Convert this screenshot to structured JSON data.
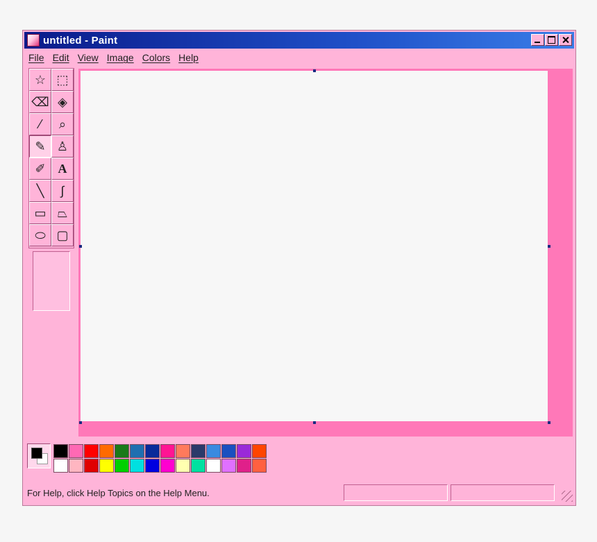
{
  "window": {
    "title": "untitled - Paint"
  },
  "menu": [
    "File",
    "Edit",
    "View",
    "Image",
    "Colors",
    "Help"
  ],
  "tools": [
    {
      "name": "free-form-select",
      "icon": "free-select-icon",
      "glyph": "☆"
    },
    {
      "name": "select",
      "icon": "rect-select-icon",
      "glyph": "⬚"
    },
    {
      "name": "eraser",
      "icon": "eraser-icon",
      "glyph": "⌫"
    },
    {
      "name": "fill-with-color",
      "icon": "paint-bucket-icon",
      "glyph": "◈"
    },
    {
      "name": "pick-color",
      "icon": "eyedropper-icon",
      "glyph": "⁄"
    },
    {
      "name": "magnifier",
      "icon": "magnifier-icon",
      "glyph": "⌕"
    },
    {
      "name": "pencil",
      "icon": "pencil-icon",
      "glyph": "✎",
      "selected": true
    },
    {
      "name": "brush",
      "icon": "brush-icon",
      "glyph": "♙"
    },
    {
      "name": "airbrush",
      "icon": "airbrush-icon",
      "glyph": "✐"
    },
    {
      "name": "text",
      "icon": "text-icon",
      "glyph": "A"
    },
    {
      "name": "line",
      "icon": "line-icon",
      "glyph": "╲"
    },
    {
      "name": "curve",
      "icon": "curve-icon",
      "glyph": "∫"
    },
    {
      "name": "rectangle",
      "icon": "rectangle-icon",
      "glyph": "▭"
    },
    {
      "name": "polygon",
      "icon": "polygon-icon",
      "glyph": "⏢"
    },
    {
      "name": "ellipse",
      "icon": "ellipse-icon",
      "glyph": "⬭"
    },
    {
      "name": "rounded-rectangle",
      "icon": "rounded-rect-icon",
      "glyph": "▢"
    }
  ],
  "colors": {
    "foreground": "#000000",
    "background": "#ffffff",
    "palette": [
      "#000000",
      "#ff69b4",
      "#ff0000",
      "#ff6a00",
      "#1a7a1a",
      "#1f6fb0",
      "#0a2a9a",
      "#ff1493",
      "#ff7a5c",
      "#2a3a6a",
      "#3a8ae0",
      "#1a50c0",
      "#9a2ad8",
      "#ff4500",
      "#ffffff",
      "#ffb6c1",
      "#e00000",
      "#ffff00",
      "#00d000",
      "#00e0e0",
      "#0000e0",
      "#ff00d0",
      "#ffffb0",
      "#00e0a0",
      "#ffffff",
      "#e070ff",
      "#e0208a",
      "#ff6040"
    ]
  },
  "status": {
    "help_text": "For Help, click Help Topics on the Help Menu."
  }
}
